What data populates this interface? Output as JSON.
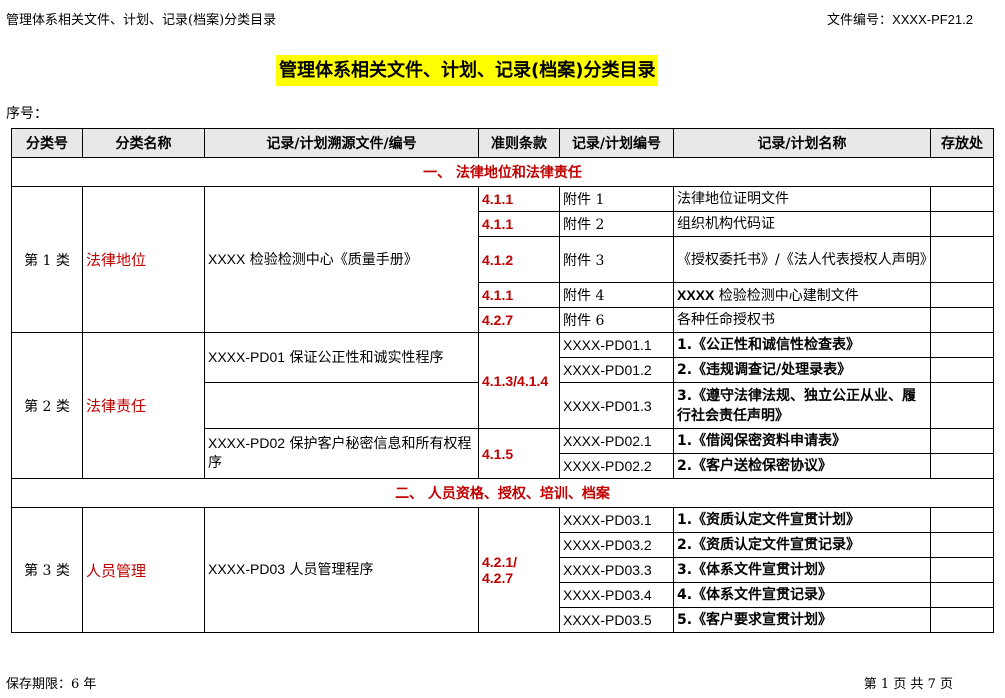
{
  "header": {
    "left_text": "管理体系相关文件、计划、记录(档案)分类目录",
    "file_no_label": "文件编号：",
    "file_no": "XXXX-PF21.2"
  },
  "title": "管理体系相关文件、计划、记录(档案)分类目录",
  "seq_label": "序号：",
  "columns": [
    "分类号",
    "分类名称",
    "记录/计划溯源文件/编号",
    "准则条款",
    "记录/计划编号",
    "记录/计划名称",
    "存放处"
  ],
  "sections": [
    {
      "label": "一、  法律地位和法律责任"
    },
    {
      "label": "二、  人员资格、授权、培训、档案"
    }
  ],
  "cat1": {
    "no": "第 1 类",
    "name": "法律地位",
    "source_prefix": "XXXX",
    "source_text": " 检验检测中心《质量手册》",
    "rows": [
      {
        "clause": "4.1.1",
        "rec_no": "附件 1",
        "rec_name": "法律地位证明文件"
      },
      {
        "clause": "4.1.1",
        "rec_no": "附件 2",
        "rec_name": "组织机构代码证"
      },
      {
        "clause": "4.1.2",
        "rec_no": "附件 3",
        "rec_name": "《授权委托书》/《法人代表授权人声明》"
      },
      {
        "clause": "4.1.1",
        "rec_no": "附件 4",
        "rec_name_bold": "XXXX",
        "rec_name": " 检验检测中心建制文件"
      },
      {
        "clause": "4.2.7",
        "rec_no": "附件 6",
        "rec_name": "各种任命授权书"
      }
    ]
  },
  "cat2": {
    "no": "第 2 类",
    "name": "法律责任",
    "source1_code": "XXXX-PD01",
    "source1_text": " 保证公正性和诚实性程序",
    "clause1": "4.1.3/4.1.4",
    "source2_code": "XXXX-PD02",
    "source2_text": "  保护客户秘密信息和所有权程序",
    "clause2": "4.1.5",
    "rows": [
      {
        "rec_no": "XXXX-PD01.1",
        "idx": "1.",
        "rec_name": "《公正性和诚信性检查表》"
      },
      {
        "rec_no": "XXXX-PD01.2",
        "idx": "2.",
        "rec_name": "《违规调查记/处理录表》"
      },
      {
        "rec_no": "XXXX-PD01.3",
        "idx": "3.",
        "rec_name": "《遵守法律法规、独立公正从业、履行社会责任声明》"
      },
      {
        "rec_no": "XXXX-PD02.1",
        "idx": "1.",
        "rec_name": "《借阅保密资料申请表》"
      },
      {
        "rec_no": "XXXX-PD02.2",
        "idx": "2.",
        "rec_name": "《客户送检保密协议》"
      }
    ]
  },
  "cat3": {
    "no": "第 3 类",
    "name": "人员管理",
    "source_code": "XXXX-PD03",
    "source_text": " 人员管理程序",
    "clause_line1": "4.2.1/",
    "clause_line2": "4.2.7",
    "rows": [
      {
        "rec_no": "XXXX-PD03.1",
        "idx": "1.",
        "rec_name": "《资质认定文件宣贯计划》"
      },
      {
        "rec_no": "XXXX-PD03.2",
        "idx": "2.",
        "rec_name": "《资质认定文件宣贯记录》"
      },
      {
        "rec_no": "XXXX-PD03.3",
        "idx": "3.",
        "rec_name": "《体系文件宣贯计划》"
      },
      {
        "rec_no": "XXXX-PD03.4",
        "idx": "4.",
        "rec_name": "《体系文件宣贯记录》"
      },
      {
        "rec_no": "XXXX-PD03.5",
        "idx": "5.",
        "rec_name": "《客户要求宣贯计划》"
      }
    ]
  },
  "footer": {
    "retention": "保存期限：6   年",
    "page": "第  1  页  共  7  页"
  }
}
